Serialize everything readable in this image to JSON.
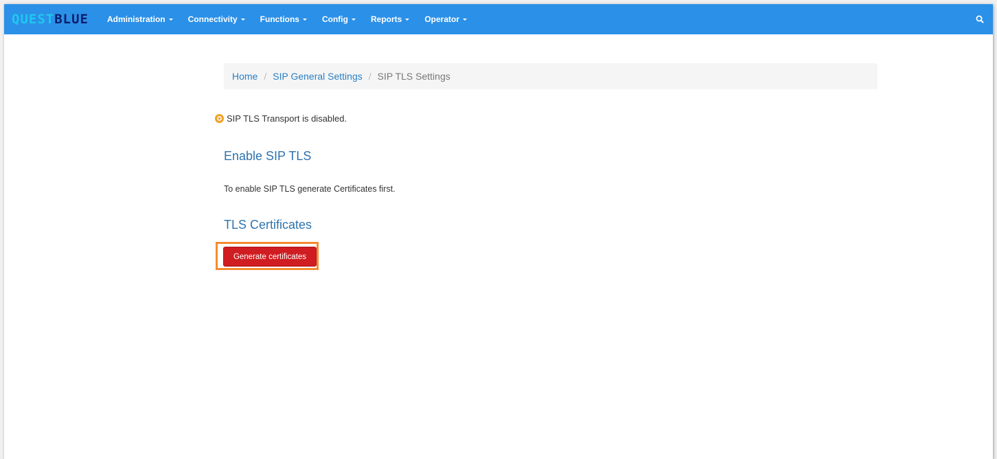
{
  "app": {
    "logo_part1": "QUEST",
    "logo_part2": "BLUE"
  },
  "nav": {
    "items": [
      {
        "label": "Administration"
      },
      {
        "label": "Connectivity"
      },
      {
        "label": "Functions"
      },
      {
        "label": "Config"
      },
      {
        "label": "Reports"
      },
      {
        "label": "Operator"
      }
    ],
    "search_icon": "search-icon"
  },
  "breadcrumb": {
    "home": "Home",
    "parent": "SIP General Settings",
    "current": "SIP TLS Settings",
    "separator": "/"
  },
  "status": {
    "icon": "warning-circle-icon",
    "text": "SIP TLS Transport is disabled."
  },
  "sections": {
    "enable_title": "Enable SIP TLS",
    "enable_text": "To enable SIP TLS generate Certificates first.",
    "certs_title": "TLS Certificates",
    "generate_label": "Generate certificates"
  },
  "colors": {
    "navbar": "#2b90e8",
    "link": "#2a7fc4",
    "heading": "#2e73ae",
    "button": "#cf1d22",
    "highlight": "#f48c2f",
    "status_icon": "#f0a125"
  }
}
